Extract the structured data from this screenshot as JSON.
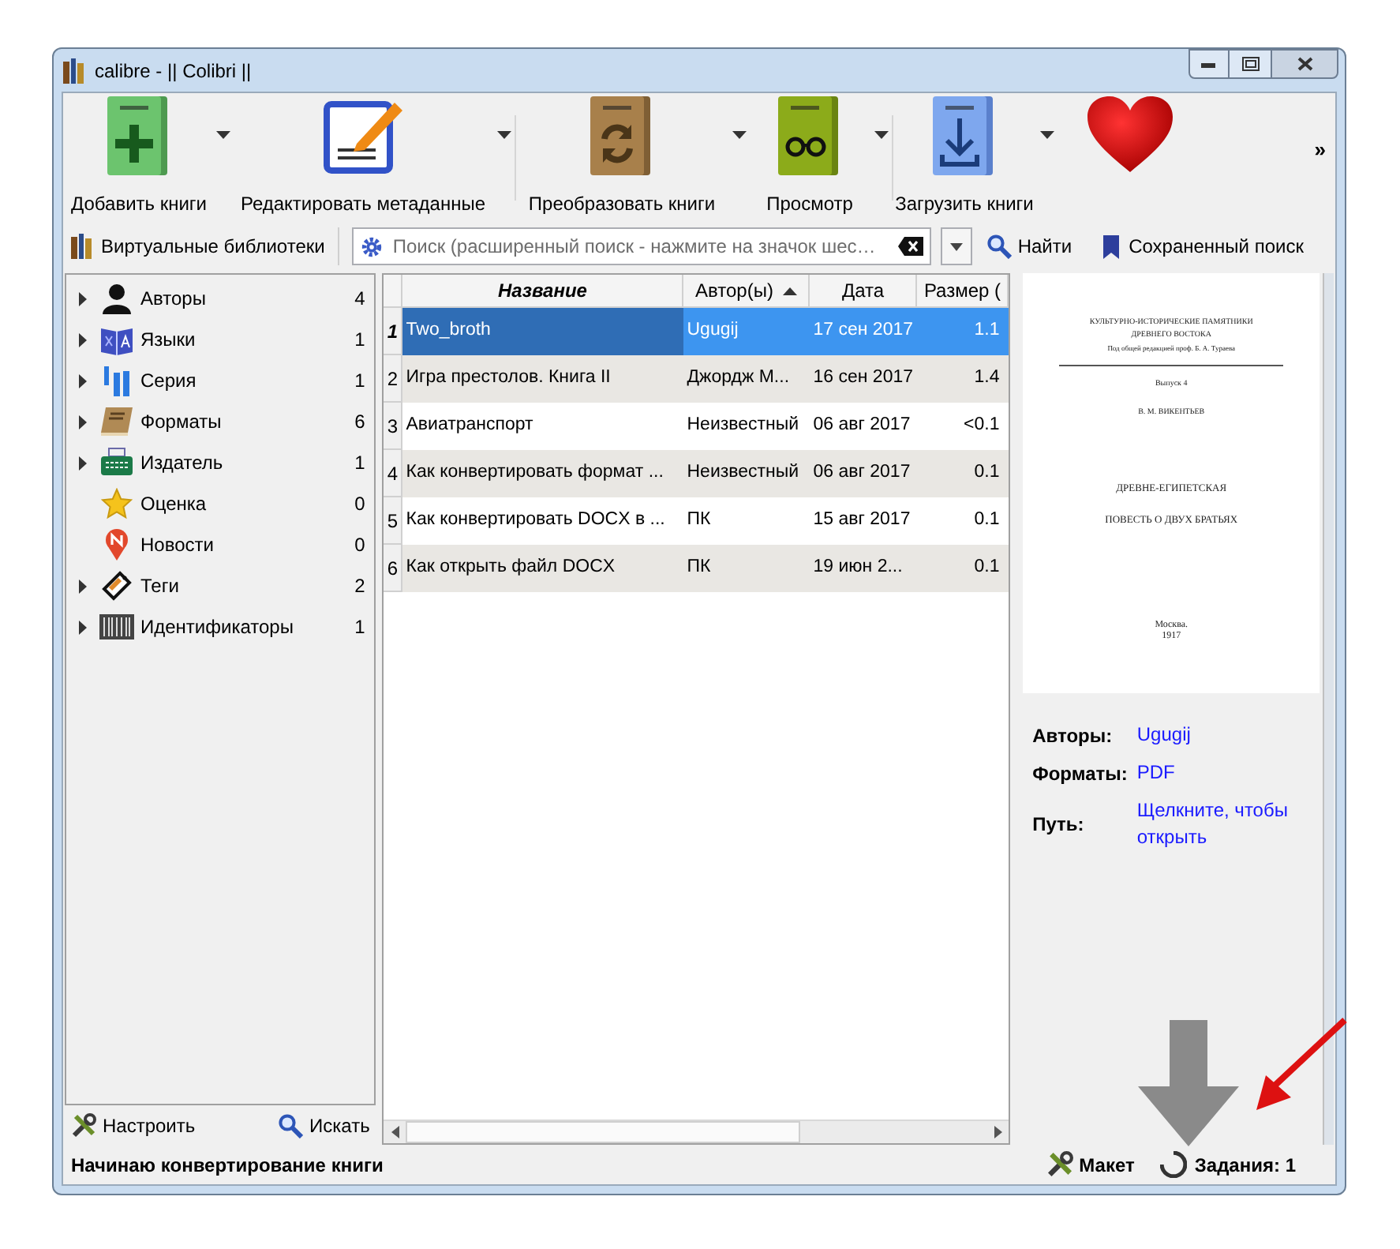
{
  "window": {
    "title": "calibre - || Colibri ||"
  },
  "toolbar": [
    {
      "kind": "add",
      "label": "Добавить книги",
      "dropdown": true
    },
    {
      "kind": "edit",
      "label": "Редактировать метаданные",
      "dropdown": true
    },
    {
      "kind": "convert",
      "label": "Преобразовать книги",
      "dropdown": true
    },
    {
      "kind": "view",
      "label": "Просмотр",
      "dropdown": true
    },
    {
      "kind": "save",
      "label": "Загрузить книги",
      "dropdown": true
    },
    {
      "kind": "heart",
      "dropdown": false
    }
  ],
  "toolbar_overflow": "»",
  "virtual_libraries": "Виртуальные библиотеки",
  "search": {
    "placeholder": "Поиск (расширенный поиск - нажмите на значок шес…"
  },
  "find_button": "Найти",
  "saved_search": "Сохраненный поиск",
  "tag_browser": [
    {
      "kind": "authors",
      "label": "Авторы",
      "count": "4",
      "expandable": true
    },
    {
      "kind": "languages",
      "label": "Языки",
      "count": "1",
      "expandable": true
    },
    {
      "kind": "series",
      "label": "Серия",
      "count": "1",
      "expandable": true
    },
    {
      "kind": "formats",
      "label": "Форматы",
      "count": "6",
      "expandable": true
    },
    {
      "kind": "publisher",
      "label": "Издатель",
      "count": "1",
      "expandable": true
    },
    {
      "kind": "rating",
      "label": "Оценка",
      "count": "0",
      "expandable": false
    },
    {
      "kind": "news",
      "label": "Новости",
      "count": "0",
      "expandable": false
    },
    {
      "kind": "tags",
      "label": "Теги",
      "count": "2",
      "expandable": true
    },
    {
      "kind": "identifiers",
      "label": "Идентификаторы",
      "count": "1",
      "expandable": true
    }
  ],
  "tag_browser_buttons": [
    {
      "kind": "configure",
      "label": "Настроить"
    },
    {
      "kind": "find",
      "label": "Искать"
    }
  ],
  "table": {
    "columns": [
      {
        "label": "Название",
        "sorted": false,
        "current": true
      },
      {
        "label": "Автор(ы)",
        "sorted": true,
        "current": false
      },
      {
        "label": "Дата",
        "sorted": false,
        "current": false
      },
      {
        "label": "Размер (",
        "sorted": false,
        "current": false
      }
    ],
    "rows": [
      {
        "number": "1",
        "cells": [
          "Two_broth",
          "Ugugij",
          "17 сен 2017",
          "1.1"
        ],
        "selected": true
      },
      {
        "number": "2",
        "cells": [
          "Игра престолов. Книга II",
          "Джордж М...",
          "16 сен 2017",
          "1.4"
        ],
        "selected": false
      },
      {
        "number": "3",
        "cells": [
          "Авиатранспорт",
          "Неизвестный",
          "06 авг 2017",
          "<0.1"
        ],
        "selected": false
      },
      {
        "number": "4",
        "cells": [
          "Как конвертировать формат ...",
          "Неизвестный",
          "06 авг 2017",
          "0.1"
        ],
        "selected": false
      },
      {
        "number": "5",
        "cells": [
          "Как конвертировать DOCX в ...",
          "ПК",
          "15 авг 2017",
          "0.1"
        ],
        "selected": false
      },
      {
        "number": "6",
        "cells": [
          "Как открыть файл DOCX",
          "ПК",
          "19 июн 2...",
          "0.1"
        ],
        "selected": false
      }
    ]
  },
  "cover": {
    "lines": [
      "КУЛЬТУРНО-ИСТОРИЧЕСКИЕ ПАМЯТНИКИ",
      "ДРЕВНЕГО ВОСТОКА",
      "Под общей редакцией проф. Б. А. Тураева"
    ],
    "issue": "Выпуск 4",
    "author": "В. М. ВИКЕНТЬЕВ",
    "title_lines": [
      "ДРЕВНЕ-ЕГИПЕТСКАЯ",
      "ПОВЕСТЬ О ДВУХ БРАТЬЯХ"
    ],
    "place": "Москва.",
    "year": "1917"
  },
  "details": [
    {
      "label": "Авторы:",
      "value": "Ugugij"
    },
    {
      "label": "Форматы:",
      "value": "PDF"
    },
    {
      "label": "Путь:",
      "value": "Щелкните, чтобы открыть"
    }
  ],
  "status_bar": {
    "message": "Начинаю конвертирование книги",
    "layout_button": "Макет",
    "jobs": "Задания: 1",
    "busy": true
  }
}
